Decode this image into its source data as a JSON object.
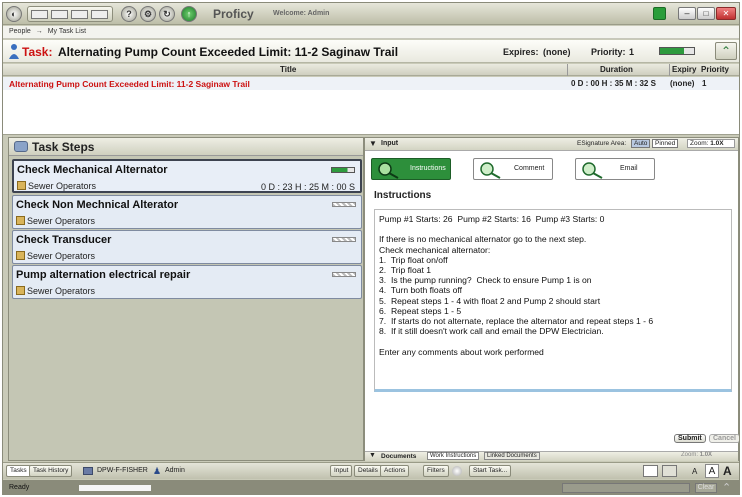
{
  "app": {
    "name": "Proficy",
    "welcome": "Welcome: Admin"
  },
  "breadcrumb": {
    "root": "People",
    "separator": "→",
    "current": "My Task List"
  },
  "task_header": {
    "label": "Task:",
    "title": "Alternating Pump Count Exceeded Limit: 11-2 Saginaw Trail",
    "expires_label": "Expires:",
    "expires_value": "(none)",
    "priority_label": "Priority:",
    "priority_value": "1",
    "progress": 0.7
  },
  "task_table": {
    "columns": [
      "Title",
      "Duration",
      "Expiry",
      "Priority"
    ],
    "rows": [
      {
        "title": "Alternating Pump Count Exceeded Limit: 11-2 Saginaw Trail",
        "duration": "0 D : 00 H : 35 M : 32 S",
        "expiry": "(none)",
        "priority": "1"
      }
    ]
  },
  "task_steps": {
    "title": "Task Steps",
    "items": [
      {
        "name": "Check Mechanical Alternator",
        "group": "Sewer Operators",
        "duration": "0 D : 23 H : 25 M : 00 S",
        "active": true,
        "progress": 0.7
      },
      {
        "name": "Check Non Mechnical Alterator",
        "group": "Sewer Operators",
        "duration": "",
        "active": false
      },
      {
        "name": "Check Transducer",
        "group": "Sewer Operators",
        "duration": "",
        "active": false
      },
      {
        "name": "Pump alternation electrical repair",
        "group": "Sewer Operators",
        "duration": "",
        "active": false
      }
    ]
  },
  "input_panel": {
    "title": "Input",
    "esig_label": "ESignature Area:",
    "esig_auto": "Auto",
    "esig_pinned": "Pinned",
    "zoom_label": "Zoom:",
    "zoom_value": "1.0X",
    "cards": [
      "Instructions",
      "Comment",
      "Email"
    ],
    "section_title": "Instructions",
    "lines": [
      "Pump #1 Starts: 26  Pump #2 Starts: 16  Pump #3 Starts: 0",
      "",
      "If there is no mechanical alternator go to the next step.",
      "Check mechanical alternator:",
      "1.  Trip float on/off",
      "2.  Trip float 1",
      "3.  Is the pump running?  Check to ensure Pump 1 is on",
      "4.  Turn both floats off",
      "5.  Repeat steps 1 - 4 with float 2 and Pump 2 should start",
      "6.  Repeat steps 1 - 5",
      "7.  If starts do not alternate, replace the alternator and repeat steps 1 - 6",
      "8.  If it still doesn't work call and email the DPW Electrician.",
      "",
      "Enter any comments about work performed"
    ],
    "submit": "Submit",
    "cancel": "Cancel"
  },
  "documents_panel": {
    "title": "Documents",
    "tab_work": "Work Instructions",
    "tab_linked": "Linked Documents",
    "zoom_label": "Zoom:",
    "zoom_value": "1.0X"
  },
  "bottom_bar": {
    "tab_tasks": "Tasks",
    "tab_history": "Task History",
    "user_group": "DPW-F-FISHER",
    "user": "Admin",
    "btn_input": "Input",
    "btn_details": "Details",
    "btn_actions": "Actions",
    "btn_filters": "Filters",
    "btn_start": "Start Task...",
    "font_small": "A",
    "font_medium": "A",
    "font_large": "A"
  },
  "status_bar": {
    "status": "Ready",
    "clear": "Clear"
  },
  "colors": {
    "accent_red": "#cc1111",
    "active_green": "#2e9b3e",
    "step_bg": "#e4ebf4"
  }
}
